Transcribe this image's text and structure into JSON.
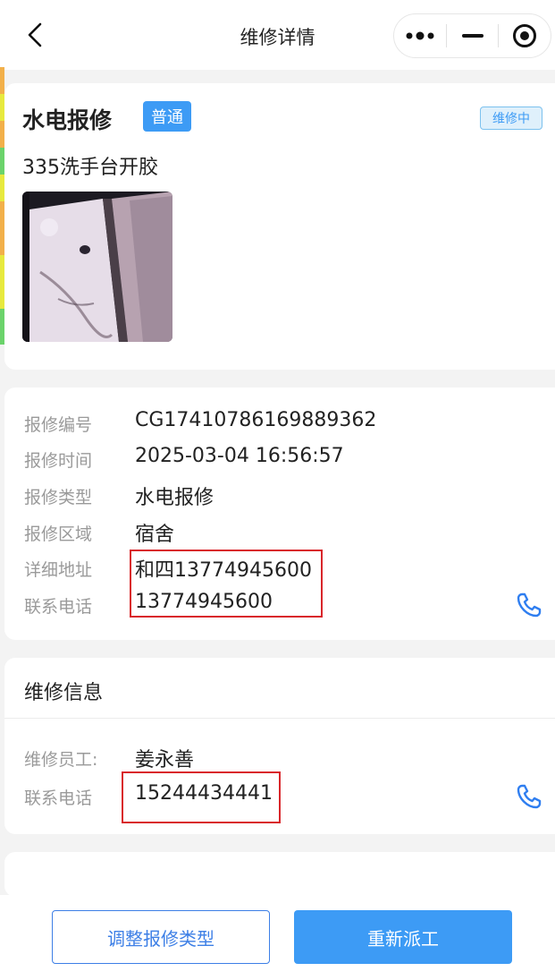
{
  "nav": {
    "title": "维修详情",
    "back_icon": "chevron-left-icon",
    "more_icon": "more-dots-icon",
    "minimize_icon": "minimize-icon",
    "close_icon": "target-circle-icon"
  },
  "summary": {
    "category": "水电报修",
    "priority_tag": "普通",
    "status": "维修中",
    "description": "335洗手台开胶"
  },
  "details": {
    "rows": [
      {
        "label": "报修编号",
        "value": "CG17410786169889362"
      },
      {
        "label": "报修时间",
        "value": "2025-03-04 16:56:57"
      },
      {
        "label": "报修类型",
        "value": "水电报修"
      },
      {
        "label": "报修区域",
        "value": "宿舍"
      },
      {
        "label": "详细地址",
        "value": "和四13774945600"
      },
      {
        "label": "联系电话",
        "value": "13774945600"
      }
    ]
  },
  "maintenance": {
    "title": "维修信息",
    "worker_label": "维修员工:",
    "worker_name": "姜永善",
    "phone_label": "联系电话",
    "phone_value": "15244434441"
  },
  "actions": {
    "adjust_label": "调整报修类型",
    "redispatch_label": "重新派工"
  },
  "colors": {
    "accent": "#3d9bf5",
    "highlight_box": "#d9262b",
    "status_bg": "#dff0fb"
  }
}
